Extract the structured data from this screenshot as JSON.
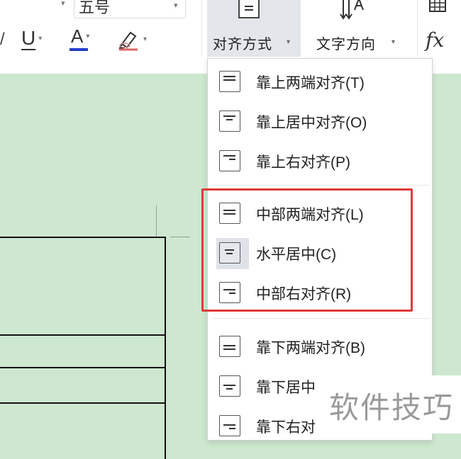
{
  "ribbon": {
    "font_size_value": "五号",
    "align_button_label": "对齐方式",
    "text_direction_label": "文字方向",
    "fx_label": "fx"
  },
  "menu": {
    "items": [
      {
        "label": "靠上两端对齐(T)",
        "icon": "align-top-justify-icon"
      },
      {
        "label": "靠上居中对齐(O)",
        "icon": "align-top-center-icon"
      },
      {
        "label": "靠上右对齐(P)",
        "icon": "align-top-right-icon"
      },
      {
        "label": "中部两端对齐(L)",
        "icon": "align-middle-justify-icon"
      },
      {
        "label": "水平居中(C)",
        "icon": "align-middle-center-icon"
      },
      {
        "label": "中部右对齐(R)",
        "icon": "align-middle-right-icon"
      },
      {
        "label": "靠下两端对齐(B)",
        "icon": "align-bottom-justify-icon"
      },
      {
        "label": "靠下居中",
        "icon": "align-bottom-center-icon"
      },
      {
        "label": "靠下右对",
        "icon": "align-bottom-right-icon"
      }
    ]
  },
  "watermark": {
    "text": "软件技巧"
  },
  "colors": {
    "document_bg": "#cde8cf",
    "highlight_box": "#e03a3a",
    "font_color_bar": "#1f3ec9"
  }
}
